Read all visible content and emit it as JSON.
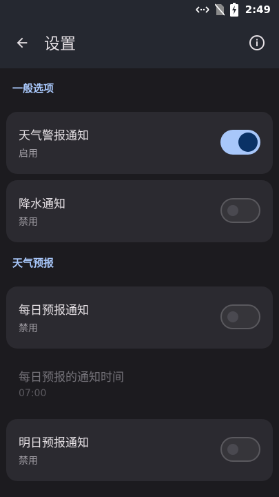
{
  "status_bar": {
    "time": "2:49",
    "icons": [
      "data-transfer-icon",
      "no-sim-icon",
      "battery-charging-icon"
    ]
  },
  "app_bar": {
    "title": "设置",
    "back_icon": "arrow-back-icon",
    "info_icon": "info-icon"
  },
  "sections": [
    {
      "header": "一般选项",
      "items": [
        {
          "label": "天气警报通知",
          "status": "启用",
          "enabled": true
        },
        {
          "label": "降水通知",
          "status": "禁用",
          "enabled": false
        }
      ]
    },
    {
      "header": "天气预报",
      "items": [
        {
          "label": "每日预报通知",
          "status": "禁用",
          "enabled": false
        },
        {
          "label": "每日预报的通知时间",
          "status": "07:00",
          "disabled_row": true
        },
        {
          "label": "明日预报通知",
          "status": "禁用",
          "enabled": false
        }
      ]
    }
  ],
  "colors": {
    "background": "#1c1b1f",
    "app_bar": "#252830",
    "card": "#2b2a30",
    "accent": "#a8c7fa",
    "switch_on_thumb": "#0a3266"
  }
}
